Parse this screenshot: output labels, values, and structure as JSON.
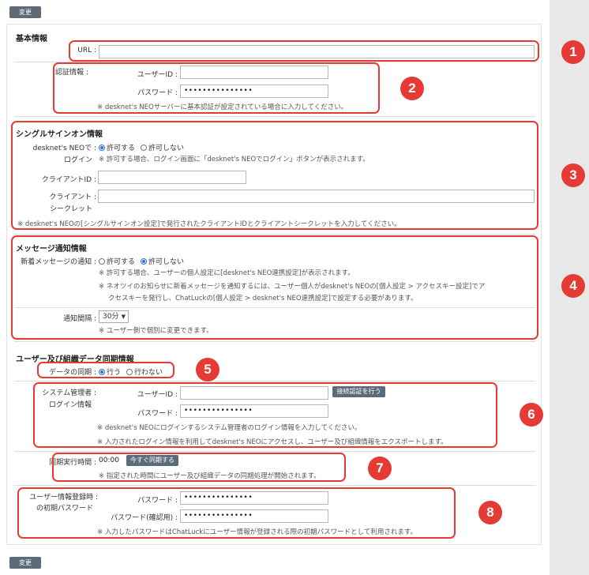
{
  "buttons": {
    "change_top": "変更",
    "change_bottom": "変更"
  },
  "basic": {
    "title": "基本情報",
    "url_label": "URL :",
    "url_value": "",
    "auth_label": "認証情報 :",
    "user_id_label": "ユーザーID :",
    "user_id_value": "",
    "password_label": "パスワード :",
    "password_value": "•••••••••••••••",
    "note": "※ desknet's NEOサーバーに基本認証が設定されている場合に入力してください。"
  },
  "sso": {
    "title": "シングルサインオン情報",
    "login_label_1": "desknet's NEOで :",
    "login_label_2": "ログイン",
    "allow": "許可する",
    "deny": "許可しない",
    "login_note": "※ 許可する場合、ログイン画面に「desknet's NEOでログイン」ボタンが表示されます。",
    "client_id_label": "クライアントID :",
    "client_secret_label_1": "クライアント :",
    "client_secret_label_2": "シークレット",
    "note": "※ desknet's NEOの[シングルサインオン設定]で発行されたクライアントIDとクライアントシークレットを入力してください。"
  },
  "message": {
    "title": "メッセージ通知情報",
    "new_msg_label": "新着メッセージの通知 :",
    "allow": "許可する",
    "deny": "許可しない",
    "note1": "※ 許可する場合、ユーザーの個人設定に[desknet's NEO連携設定]が表示されます。",
    "note2a": "※ ネオツイのお知らせに新着メッセージを通知するには、ユーザー個人がdesknet's NEOの[個人設定 > アクセスキー設定]でア",
    "note2b": "クセスキーを発行し、ChatLuckの[個人設定 > desknet's NEO連携設定]で設定する必要があります。",
    "interval_label": "通知間隔 :",
    "interval_value": "30分",
    "interval_note": "※ ユーザー側で個別に変更できます。"
  },
  "sync": {
    "title": "ユーザー及び組織データ同期情報",
    "data_sync_label": "データの同期 :",
    "do": "行う",
    "dont": "行わない",
    "admin_label_1": "システム管理者 :",
    "admin_label_2": "ログイン情報",
    "user_id_label": "ユーザーID :",
    "test_button": "接続認証を行う",
    "password_label": "パスワード :",
    "password_value": "•••••••••••••••",
    "admin_note1": "※ desknet's NEOにログインするシステム管理者のログイン情報を入力してください。",
    "admin_note2": "※ 入力されたログイン情報を利用してdesknet's NEOにアクセスし、ユーザー及び組織情報をエクスポートします。",
    "exec_time_label": "同期実行時間 :",
    "exec_time_value": "00:00",
    "sync_now_button": "今すぐ同期する",
    "exec_note": "※ 指定された時間にユーザー及び組織データの同期処理が開始されます。",
    "init_pw_label_1": "ユーザー情報登録時 :",
    "init_pw_label_2": "の初期パスワード",
    "pw_label": "パスワード :",
    "pw_value": "•••••••••••••••",
    "pw_confirm_label": "パスワード(確認用) :",
    "pw_confirm_value": "•••••••••••••••",
    "pw_note": "※ 入力したパスワードはChatLuckにユーザー情報が登録される際の初期パスワードとして利用されます。"
  },
  "badges": [
    "1",
    "2",
    "3",
    "4",
    "5",
    "6",
    "7",
    "8"
  ],
  "colors": {
    "highlight": "#e63b34",
    "button": "#5c6b7a",
    "radio": "#2a6fdb"
  }
}
